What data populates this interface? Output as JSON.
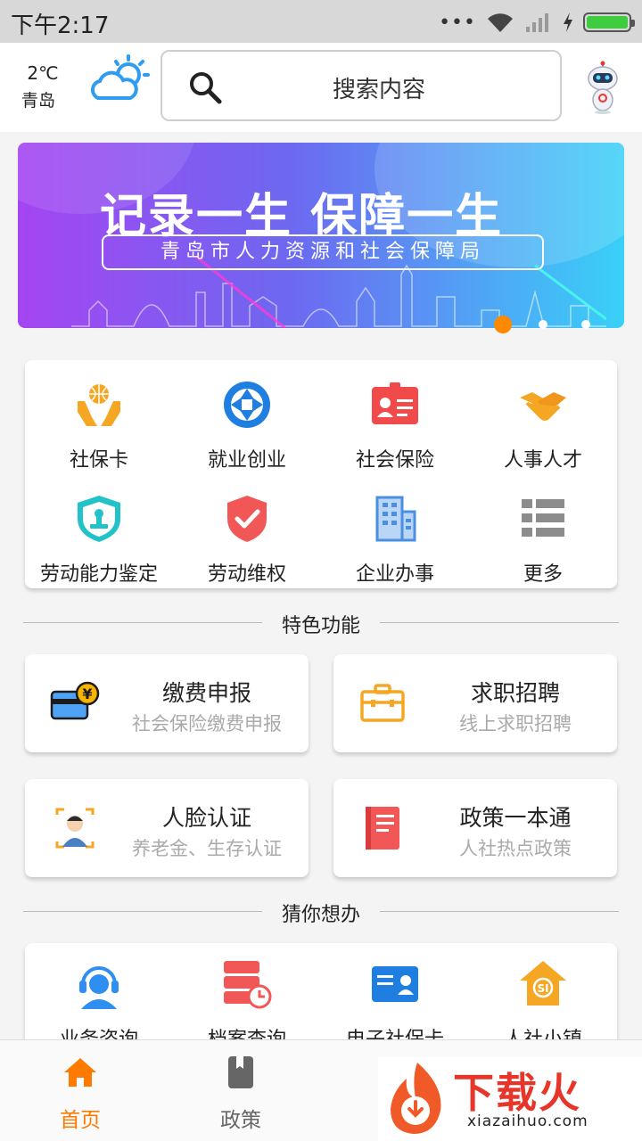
{
  "status_bar": {
    "time": "下午2:17",
    "dots": "•••"
  },
  "header": {
    "temperature": "2℃",
    "city": "青岛",
    "search_placeholder": "搜索内容"
  },
  "banner": {
    "slogan": "记录一生  保障一生",
    "subtitle": "青岛市人力资源和社会保障局",
    "active_slide": 1,
    "slide_count": 3
  },
  "services": [
    {
      "label": "社保卡",
      "icon": "hands-globe-icon"
    },
    {
      "label": "就业创业",
      "icon": "aperture-icon"
    },
    {
      "label": "社会保险",
      "icon": "id-card-icon"
    },
    {
      "label": "人事人才",
      "icon": "handshake-icon"
    },
    {
      "label": "劳动能力鉴定",
      "icon": "shield-stamp-icon"
    },
    {
      "label": "劳动维权",
      "icon": "shield-check-icon"
    },
    {
      "label": "企业办事",
      "icon": "building-icon"
    },
    {
      "label": "更多",
      "icon": "list-icon"
    }
  ],
  "sections": {
    "featured": "特色功能",
    "guess": "猜你想办"
  },
  "features": [
    {
      "title": "缴费申报",
      "subtitle": "社会保险缴费申报",
      "icon": "card-yen-icon"
    },
    {
      "title": "求职招聘",
      "subtitle": "线上求职招聘",
      "icon": "briefcase-icon"
    },
    {
      "title": "人脸认证",
      "subtitle": "养老金、生存认证",
      "icon": "face-scan-icon"
    },
    {
      "title": "政策一本通",
      "subtitle": "人社热点政策",
      "icon": "book-icon"
    }
  ],
  "guess_items": [
    {
      "label": "业务咨询",
      "icon": "headset-icon"
    },
    {
      "label": "档案查询",
      "icon": "archive-clock-icon"
    },
    {
      "label": "电子社保卡",
      "icon": "e-card-icon"
    },
    {
      "label": "人社小镇",
      "icon": "house-si-icon"
    }
  ],
  "nav": [
    {
      "label": "首页",
      "icon": "home-icon",
      "active": true
    },
    {
      "label": "政策",
      "icon": "book-nav-icon",
      "active": false
    }
  ],
  "colors": {
    "accent": "#ff7a00",
    "nav_inactive": "#666666"
  },
  "watermark": {
    "brand": "下载火",
    "url": "xiazaihuo.com"
  }
}
